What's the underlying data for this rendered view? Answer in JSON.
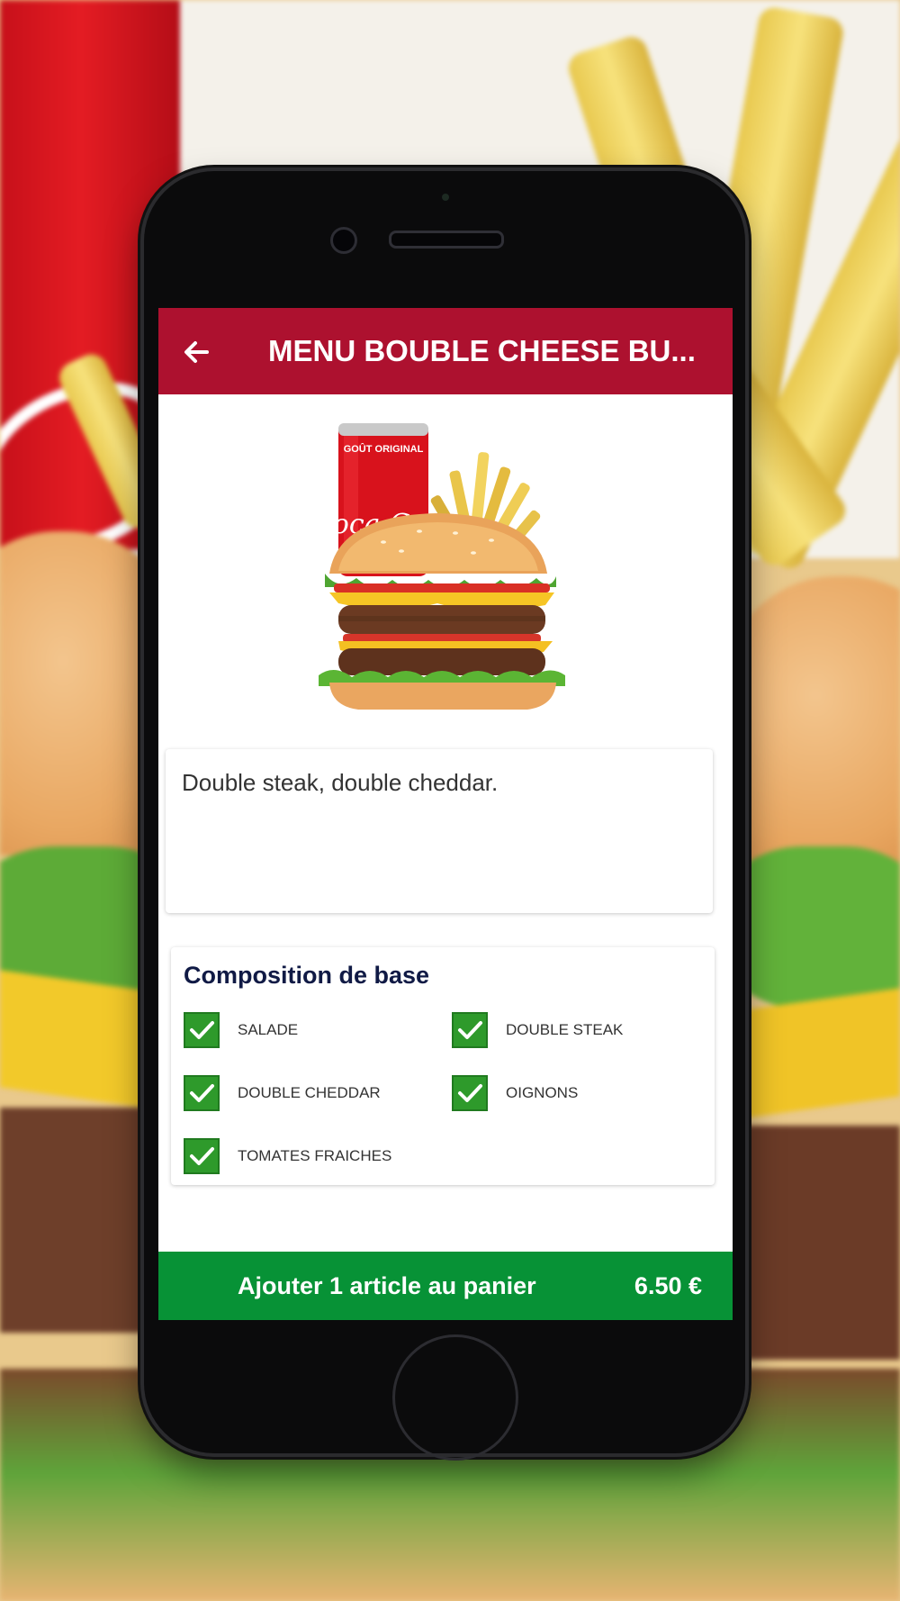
{
  "header": {
    "title": "MENU BOUBLE CHEESE BU...",
    "back_icon": "arrow-left-icon"
  },
  "product": {
    "image": "burger-menu-image",
    "can_text": "GOÛT ORIGINAL",
    "can_brand": "Coca-Cola",
    "description": "Double steak, double cheddar."
  },
  "composition": {
    "title": "Composition de base",
    "items": [
      {
        "label": "SALADE",
        "checked": true
      },
      {
        "label": "DOUBLE STEAK",
        "checked": true
      },
      {
        "label": "DOUBLE CHEDDAR",
        "checked": true
      },
      {
        "label": "OIGNONS",
        "checked": true
      },
      {
        "label": "TOMATES FRAICHES",
        "checked": true
      }
    ]
  },
  "cart": {
    "label": "Ajouter 1 article au panier",
    "price": "6.50 €"
  },
  "colors": {
    "appbar": "#ad112f",
    "cta": "#079236",
    "checkbox": "#2e9a2b",
    "section_title": "#101a45"
  }
}
